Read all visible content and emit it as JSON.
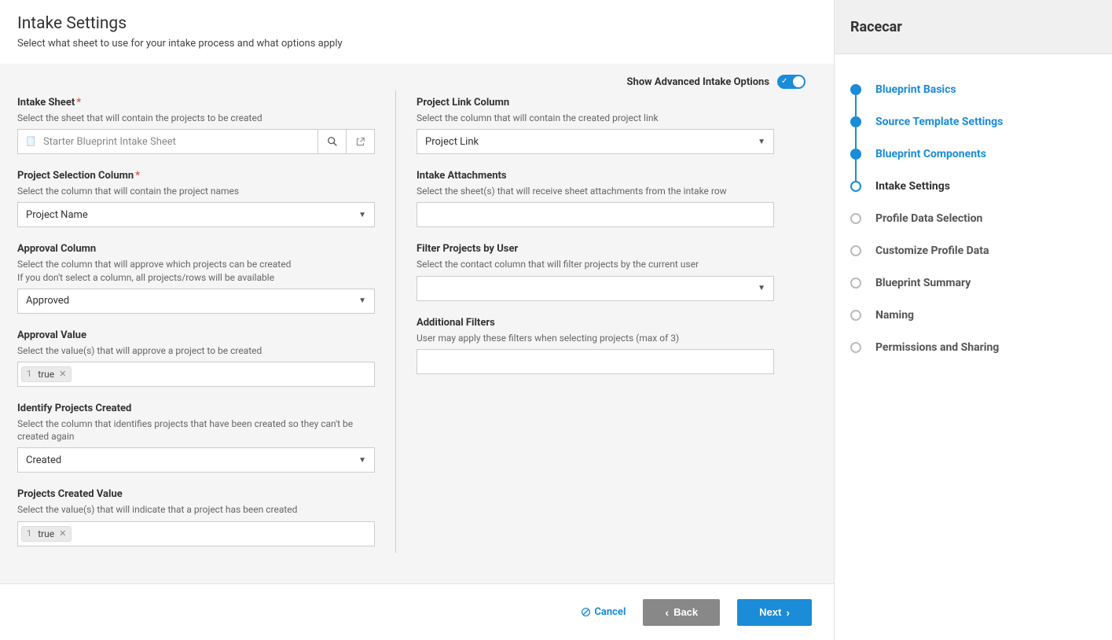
{
  "header": {
    "title": "Intake Settings",
    "subtitle": "Select what sheet to use for your intake process and what options apply"
  },
  "advanced": {
    "label": "Show Advanced Intake Options"
  },
  "left": {
    "intake_sheet": {
      "label": "Intake Sheet",
      "help": "Select the sheet that will contain the projects to be created",
      "value": "Starter Blueprint Intake Sheet"
    },
    "project_selection": {
      "label": "Project Selection Column",
      "help": "Select the column that will contain the project names",
      "value": "Project Name"
    },
    "approval_column": {
      "label": "Approval Column",
      "help1": "Select the column that will approve which projects can be created",
      "help2": "If you don't select a column, all projects/rows will be available",
      "value": "Approved"
    },
    "approval_value": {
      "label": "Approval Value",
      "help": "Select the value(s) that will approve a project to be created",
      "tag_num": "1",
      "tag_text": "true"
    },
    "identify": {
      "label": "Identify Projects Created",
      "help": "Select the column that identifies projects that have been created so they can't be created again",
      "value": "Created"
    },
    "created_value": {
      "label": "Projects Created Value",
      "help": "Select the value(s) that will indicate that a project has been created",
      "tag_num": "1",
      "tag_text": "true"
    }
  },
  "right": {
    "project_link": {
      "label": "Project Link Column",
      "help": "Select the column that will contain the created project link",
      "value": "Project Link"
    },
    "attachments": {
      "label": "Intake Attachments",
      "help": "Select the sheet(s) that will receive sheet attachments from the intake row"
    },
    "filter_user": {
      "label": "Filter Projects by User",
      "help": "Select the contact column that will filter projects by the current user"
    },
    "additional_filters": {
      "label": "Additional Filters",
      "help": "User may apply these filters when selecting projects (max of 3)"
    }
  },
  "footer": {
    "cancel": "Cancel",
    "back": "Back",
    "next": "Next"
  },
  "side": {
    "title": "Racecar",
    "steps": [
      {
        "label": "Blueprint Basics",
        "state": "done"
      },
      {
        "label": "Source Template Settings",
        "state": "done"
      },
      {
        "label": "Blueprint Components",
        "state": "done"
      },
      {
        "label": "Intake Settings",
        "state": "current"
      },
      {
        "label": "Profile Data Selection",
        "state": "future"
      },
      {
        "label": "Customize Profile Data",
        "state": "future"
      },
      {
        "label": "Blueprint Summary",
        "state": "future"
      },
      {
        "label": "Naming",
        "state": "future"
      },
      {
        "label": "Permissions and Sharing",
        "state": "future"
      }
    ]
  },
  "req_marker": "*"
}
